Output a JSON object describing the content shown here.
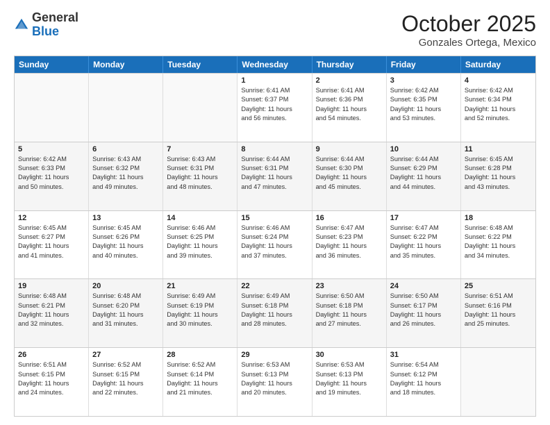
{
  "logo": {
    "general": "General",
    "blue": "Blue"
  },
  "title": "October 2025",
  "subtitle": "Gonzales Ortega, Mexico",
  "days_of_week": [
    "Sunday",
    "Monday",
    "Tuesday",
    "Wednesday",
    "Thursday",
    "Friday",
    "Saturday"
  ],
  "weeks": [
    [
      {
        "day": "",
        "info": ""
      },
      {
        "day": "",
        "info": ""
      },
      {
        "day": "",
        "info": ""
      },
      {
        "day": "1",
        "info": "Sunrise: 6:41 AM\nSunset: 6:37 PM\nDaylight: 11 hours\nand 56 minutes."
      },
      {
        "day": "2",
        "info": "Sunrise: 6:41 AM\nSunset: 6:36 PM\nDaylight: 11 hours\nand 54 minutes."
      },
      {
        "day": "3",
        "info": "Sunrise: 6:42 AM\nSunset: 6:35 PM\nDaylight: 11 hours\nand 53 minutes."
      },
      {
        "day": "4",
        "info": "Sunrise: 6:42 AM\nSunset: 6:34 PM\nDaylight: 11 hours\nand 52 minutes."
      }
    ],
    [
      {
        "day": "5",
        "info": "Sunrise: 6:42 AM\nSunset: 6:33 PM\nDaylight: 11 hours\nand 50 minutes."
      },
      {
        "day": "6",
        "info": "Sunrise: 6:43 AM\nSunset: 6:32 PM\nDaylight: 11 hours\nand 49 minutes."
      },
      {
        "day": "7",
        "info": "Sunrise: 6:43 AM\nSunset: 6:31 PM\nDaylight: 11 hours\nand 48 minutes."
      },
      {
        "day": "8",
        "info": "Sunrise: 6:44 AM\nSunset: 6:31 PM\nDaylight: 11 hours\nand 47 minutes."
      },
      {
        "day": "9",
        "info": "Sunrise: 6:44 AM\nSunset: 6:30 PM\nDaylight: 11 hours\nand 45 minutes."
      },
      {
        "day": "10",
        "info": "Sunrise: 6:44 AM\nSunset: 6:29 PM\nDaylight: 11 hours\nand 44 minutes."
      },
      {
        "day": "11",
        "info": "Sunrise: 6:45 AM\nSunset: 6:28 PM\nDaylight: 11 hours\nand 43 minutes."
      }
    ],
    [
      {
        "day": "12",
        "info": "Sunrise: 6:45 AM\nSunset: 6:27 PM\nDaylight: 11 hours\nand 41 minutes."
      },
      {
        "day": "13",
        "info": "Sunrise: 6:45 AM\nSunset: 6:26 PM\nDaylight: 11 hours\nand 40 minutes."
      },
      {
        "day": "14",
        "info": "Sunrise: 6:46 AM\nSunset: 6:25 PM\nDaylight: 11 hours\nand 39 minutes."
      },
      {
        "day": "15",
        "info": "Sunrise: 6:46 AM\nSunset: 6:24 PM\nDaylight: 11 hours\nand 37 minutes."
      },
      {
        "day": "16",
        "info": "Sunrise: 6:47 AM\nSunset: 6:23 PM\nDaylight: 11 hours\nand 36 minutes."
      },
      {
        "day": "17",
        "info": "Sunrise: 6:47 AM\nSunset: 6:22 PM\nDaylight: 11 hours\nand 35 minutes."
      },
      {
        "day": "18",
        "info": "Sunrise: 6:48 AM\nSunset: 6:22 PM\nDaylight: 11 hours\nand 34 minutes."
      }
    ],
    [
      {
        "day": "19",
        "info": "Sunrise: 6:48 AM\nSunset: 6:21 PM\nDaylight: 11 hours\nand 32 minutes."
      },
      {
        "day": "20",
        "info": "Sunrise: 6:48 AM\nSunset: 6:20 PM\nDaylight: 11 hours\nand 31 minutes."
      },
      {
        "day": "21",
        "info": "Sunrise: 6:49 AM\nSunset: 6:19 PM\nDaylight: 11 hours\nand 30 minutes."
      },
      {
        "day": "22",
        "info": "Sunrise: 6:49 AM\nSunset: 6:18 PM\nDaylight: 11 hours\nand 28 minutes."
      },
      {
        "day": "23",
        "info": "Sunrise: 6:50 AM\nSunset: 6:18 PM\nDaylight: 11 hours\nand 27 minutes."
      },
      {
        "day": "24",
        "info": "Sunrise: 6:50 AM\nSunset: 6:17 PM\nDaylight: 11 hours\nand 26 minutes."
      },
      {
        "day": "25",
        "info": "Sunrise: 6:51 AM\nSunset: 6:16 PM\nDaylight: 11 hours\nand 25 minutes."
      }
    ],
    [
      {
        "day": "26",
        "info": "Sunrise: 6:51 AM\nSunset: 6:15 PM\nDaylight: 11 hours\nand 24 minutes."
      },
      {
        "day": "27",
        "info": "Sunrise: 6:52 AM\nSunset: 6:15 PM\nDaylight: 11 hours\nand 22 minutes."
      },
      {
        "day": "28",
        "info": "Sunrise: 6:52 AM\nSunset: 6:14 PM\nDaylight: 11 hours\nand 21 minutes."
      },
      {
        "day": "29",
        "info": "Sunrise: 6:53 AM\nSunset: 6:13 PM\nDaylight: 11 hours\nand 20 minutes."
      },
      {
        "day": "30",
        "info": "Sunrise: 6:53 AM\nSunset: 6:13 PM\nDaylight: 11 hours\nand 19 minutes."
      },
      {
        "day": "31",
        "info": "Sunrise: 6:54 AM\nSunset: 6:12 PM\nDaylight: 11 hours\nand 18 minutes."
      },
      {
        "day": "",
        "info": ""
      }
    ]
  ]
}
